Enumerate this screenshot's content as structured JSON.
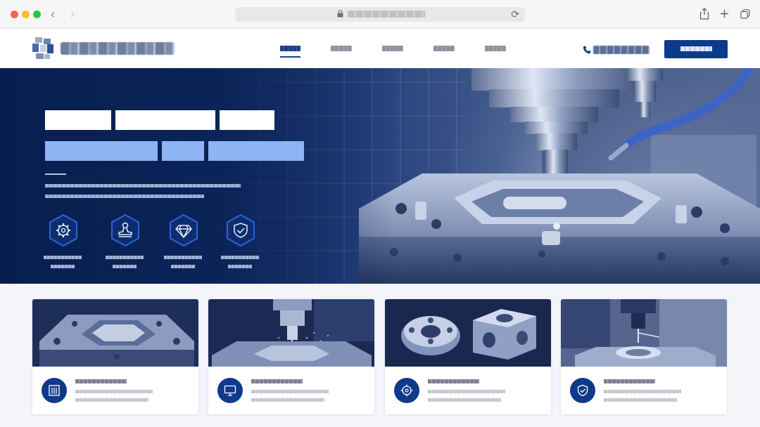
{
  "browser": {
    "url": "",
    "back_label": "‹",
    "forward_label": "›"
  },
  "header": {
    "brand_name": "",
    "nav": [
      {
        "label": "",
        "active": true
      },
      {
        "label": "",
        "active": false
      },
      {
        "label": "",
        "active": false
      },
      {
        "label": "",
        "active": false
      },
      {
        "label": "",
        "active": false
      }
    ],
    "phone": "",
    "cta_label": ""
  },
  "hero": {
    "title_line_1": "",
    "title_line_2": "",
    "description_line_1": "",
    "description_line_2": "",
    "features": [
      {
        "icon": "gear-icon",
        "label_line_1": "",
        "label_line_2": ""
      },
      {
        "icon": "stamp-icon",
        "label_line_1": "",
        "label_line_2": ""
      },
      {
        "icon": "diamond-icon",
        "label_line_1": "",
        "label_line_2": ""
      },
      {
        "icon": "shield-check-icon",
        "label_line_1": "",
        "label_line_2": ""
      }
    ]
  },
  "cards": [
    {
      "icon": "building-icon",
      "image": "mold-base",
      "title": "",
      "line_1": "",
      "line_2": ""
    },
    {
      "icon": "monitor-icon",
      "image": "cnc-machining",
      "title": "",
      "line_1": "",
      "line_2": ""
    },
    {
      "icon": "target-icon",
      "image": "machined-parts",
      "title": "",
      "line_1": "",
      "line_2": ""
    },
    {
      "icon": "shield-check-icon",
      "image": "cmm-inspection",
      "title": "",
      "line_1": "",
      "line_2": ""
    }
  ],
  "colors": {
    "brand_navy": "#0e3a8a",
    "hero_dark": "#0b2457",
    "hero_accent": "#8fb4f4"
  }
}
